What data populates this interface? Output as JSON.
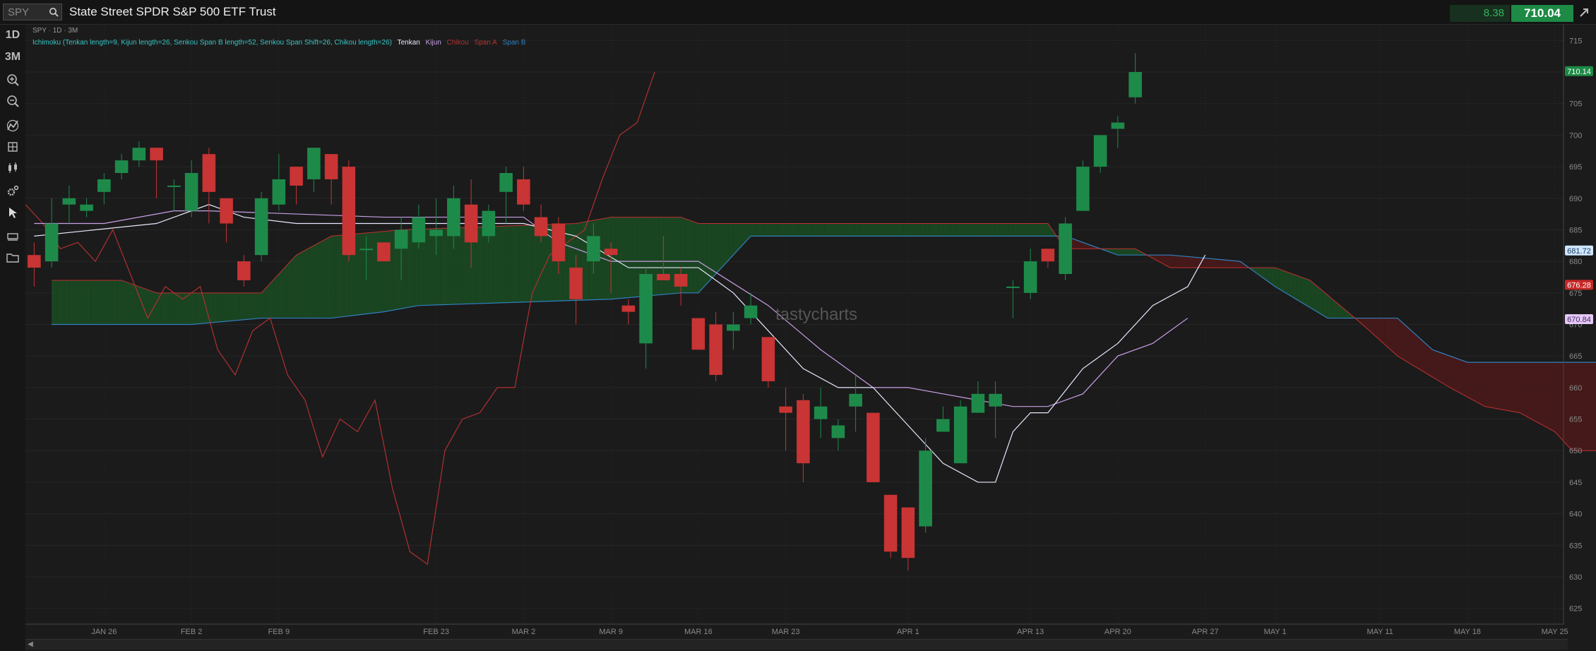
{
  "header": {
    "symbol": "SPY",
    "title": "State Street SPDR S&P 500 ETF Trust",
    "change": "8.38",
    "price": "710.04"
  },
  "sidebar": {
    "timeframes": [
      "1D",
      "3M"
    ],
    "tools": [
      "zoom-in-icon",
      "zoom-out-icon",
      "studies-icon",
      "drawing-icon",
      "chart-style-icon",
      "settings-icon",
      "cursor-icon",
      "layers-icon",
      "folder-icon"
    ]
  },
  "chart": {
    "info": "SPY · 1D · 3M",
    "study_params": "Ichimoku (Tenkan length=9, Kijun length=26, Senkou Span B length=52, Senkou Span Shift=26, Chikou length=26)",
    "legend": [
      {
        "label": "Tenkan",
        "color": "#e8e8ff"
      },
      {
        "label": "Kijun",
        "color": "#c8a0e8"
      },
      {
        "label": "Chikou",
        "color": "#b03030"
      },
      {
        "label": "Span A",
        "color": "#c03030"
      },
      {
        "label": "Span B",
        "color": "#3080c0"
      }
    ],
    "watermark": "tastycharts",
    "price_badges": [
      {
        "value": "710.14",
        "bg": "#1d8a45",
        "fg": "#ffffff"
      },
      {
        "value": "681.72",
        "bg": "#cfe6ff",
        "fg": "#1a3a5a"
      },
      {
        "value": "676.28",
        "bg": "#c62828",
        "fg": "#ffffff"
      },
      {
        "value": "670.84",
        "bg": "#e4c9f5",
        "fg": "#4a2a6a"
      }
    ]
  },
  "chart_data": {
    "type": "candlestick",
    "ylim": [
      622.5,
      717.5
    ],
    "y_ticks": [
      625,
      630,
      635,
      640,
      645,
      650,
      655,
      660,
      665,
      670,
      675,
      680,
      685,
      690,
      695,
      700,
      705,
      710,
      715
    ],
    "x_labels": [
      "JAN 26",
      "FEB 2",
      "FEB 9",
      "FEB 23",
      "MAR 2",
      "MAR 9",
      "MAR 16",
      "MAR 23",
      "APR 1",
      "APR 13",
      "APR 20",
      "APR 27",
      "MAY 1",
      "MAY 11",
      "MAY 18",
      "MAY 25"
    ],
    "x_label_index": [
      4,
      9,
      14,
      23,
      28,
      33,
      38,
      43,
      50,
      57,
      62,
      67,
      71,
      77,
      82,
      87
    ],
    "x_range": [
      -0.5,
      87.5
    ],
    "colors": {
      "up": "#1e8a4a",
      "down": "#c93434",
      "cloud_green": "#1b4a22",
      "cloud_red": "#4a1a1a"
    },
    "candles": [
      [
        681,
        679,
        683,
        676
      ],
      [
        680,
        686,
        690,
        679
      ],
      [
        689,
        690,
        692,
        686
      ],
      [
        688,
        689,
        690,
        687
      ],
      [
        691,
        693,
        694,
        689
      ],
      [
        694,
        696,
        697,
        693
      ],
      [
        696,
        698,
        699,
        695
      ],
      [
        698,
        696,
        698,
        690
      ],
      [
        692,
        692,
        693,
        688
      ],
      [
        688,
        694,
        696,
        687
      ],
      [
        697,
        691,
        698,
        686
      ],
      [
        690,
        686,
        690,
        683
      ],
      [
        680,
        677,
        681,
        676
      ],
      [
        681,
        690,
        691,
        680
      ],
      [
        689,
        693,
        697,
        688
      ],
      [
        695,
        692,
        695,
        689
      ],
      [
        693,
        698,
        698,
        691
      ],
      [
        697,
        693,
        697,
        689
      ],
      [
        695,
        681,
        696,
        680
      ],
      [
        682,
        682,
        684,
        677
      ],
      [
        683,
        680,
        682,
        683
      ],
      [
        682,
        685,
        687,
        677
      ],
      [
        683,
        687,
        689,
        682
      ],
      [
        684,
        685,
        690,
        681
      ],
      [
        684,
        690,
        692,
        682
      ],
      [
        689,
        683,
        693,
        679
      ],
      [
        684,
        688,
        689,
        683
      ],
      [
        691,
        694,
        695,
        686
      ],
      [
        693,
        689,
        695,
        688
      ],
      [
        687,
        684,
        689,
        683
      ],
      [
        686,
        680,
        687,
        678
      ],
      [
        679,
        674,
        681,
        670
      ],
      [
        680,
        684,
        686,
        678
      ],
      [
        682,
        681,
        683,
        675
      ],
      [
        673,
        672,
        674,
        670
      ],
      [
        667,
        678,
        679,
        663
      ],
      [
        678,
        677,
        684,
        677
      ],
      [
        678,
        676,
        679,
        673
      ],
      [
        671,
        666,
        671,
        666
      ],
      [
        670,
        662,
        672,
        661
      ],
      [
        669,
        670,
        672,
        666
      ],
      [
        671,
        673,
        675,
        670
      ],
      [
        668,
        661,
        668,
        660
      ],
      [
        657,
        656,
        660,
        650
      ],
      [
        658,
        648,
        659,
        645
      ],
      [
        655,
        657,
        660,
        652
      ],
      [
        652,
        654,
        655,
        650
      ],
      [
        657,
        659,
        662,
        653
      ],
      [
        656,
        645,
        656,
        645
      ],
      [
        643,
        634,
        643,
        633
      ],
      [
        641,
        633,
        641,
        631
      ],
      [
        638,
        650,
        652,
        637
      ],
      [
        653,
        655,
        657,
        653
      ],
      [
        648,
        657,
        658,
        648
      ],
      [
        656,
        659,
        661,
        656
      ],
      [
        657,
        659,
        661,
        652
      ],
      [
        676,
        676,
        677,
        671
      ],
      [
        675,
        680,
        682,
        674
      ],
      [
        682,
        680,
        682,
        679
      ],
      [
        678,
        686,
        687,
        677
      ],
      [
        688,
        695,
        696,
        688
      ],
      [
        695,
        700,
        700,
        694
      ],
      [
        701,
        702,
        703,
        698
      ],
      [
        706,
        710,
        713,
        705
      ]
    ],
    "chikou": [
      [
        -0.5,
        689
      ],
      [
        0.5,
        686
      ],
      [
        1.5,
        682
      ],
      [
        2.5,
        683
      ],
      [
        3.5,
        680
      ],
      [
        4.5,
        685
      ],
      [
        5.5,
        678
      ],
      [
        6.5,
        671
      ],
      [
        7.5,
        676
      ],
      [
        8.5,
        674
      ],
      [
        9.5,
        676
      ],
      [
        10.5,
        666
      ],
      [
        11.5,
        662
      ],
      [
        12.5,
        669
      ],
      [
        13.5,
        671
      ],
      [
        14.5,
        662
      ],
      [
        15.5,
        658
      ],
      [
        16.5,
        649
      ],
      [
        17.5,
        655
      ],
      [
        18.5,
        653
      ],
      [
        19.5,
        658
      ],
      [
        20.5,
        644
      ],
      [
        21.5,
        634
      ],
      [
        22.5,
        632
      ],
      [
        23.5,
        650
      ],
      [
        24.5,
        655
      ],
      [
        25.5,
        656
      ],
      [
        26.5,
        660
      ],
      [
        27.5,
        660
      ],
      [
        28.5,
        675
      ],
      [
        29.5,
        681
      ],
      [
        30.5,
        683
      ],
      [
        31.5,
        685
      ],
      [
        32.5,
        693
      ],
      [
        33.5,
        700
      ],
      [
        34.5,
        702
      ],
      [
        35.5,
        710
      ]
    ],
    "tenkan": [
      [
        0,
        684
      ],
      [
        7,
        686
      ],
      [
        10,
        689
      ],
      [
        12,
        687
      ],
      [
        15,
        686
      ],
      [
        28,
        686
      ],
      [
        31,
        684
      ],
      [
        34,
        679
      ],
      [
        38,
        679
      ],
      [
        40,
        675
      ],
      [
        42,
        669
      ],
      [
        44,
        663
      ],
      [
        46,
        660
      ],
      [
        48,
        660
      ],
      [
        50,
        654
      ],
      [
        52,
        648
      ],
      [
        54,
        645
      ],
      [
        55,
        645
      ],
      [
        56,
        653
      ],
      [
        57,
        656
      ],
      [
        58,
        656
      ],
      [
        60,
        663
      ],
      [
        62,
        667
      ],
      [
        64,
        673
      ],
      [
        66,
        676
      ],
      [
        67,
        681
      ]
    ],
    "kijun": [
      [
        0,
        686
      ],
      [
        4,
        686
      ],
      [
        8,
        688
      ],
      [
        10,
        688
      ],
      [
        20,
        687
      ],
      [
        28,
        687
      ],
      [
        30,
        683
      ],
      [
        33,
        680
      ],
      [
        38,
        680
      ],
      [
        42,
        673
      ],
      [
        45,
        666
      ],
      [
        48,
        660
      ],
      [
        50,
        660
      ],
      [
        52,
        659
      ],
      [
        54,
        658
      ],
      [
        56,
        657
      ],
      [
        58,
        657
      ],
      [
        60,
        659
      ],
      [
        62,
        665
      ],
      [
        64,
        667
      ],
      [
        66,
        671
      ]
    ],
    "span_a": [
      [
        1,
        677
      ],
      [
        5,
        677
      ],
      [
        7,
        675
      ],
      [
        13,
        675
      ],
      [
        15,
        681
      ],
      [
        17,
        684
      ],
      [
        21,
        685
      ],
      [
        31,
        686
      ],
      [
        33,
        687
      ],
      [
        37,
        687
      ],
      [
        38,
        686
      ],
      [
        54,
        686
      ],
      [
        58,
        686
      ],
      [
        59,
        682
      ],
      [
        63,
        682
      ],
      [
        65,
        679
      ],
      [
        71,
        679
      ],
      [
        73,
        677
      ],
      [
        76,
        670
      ],
      [
        78,
        665
      ],
      [
        81,
        660
      ],
      [
        83,
        657
      ],
      [
        85,
        656
      ],
      [
        87,
        653
      ],
      [
        88,
        650
      ],
      [
        91,
        650
      ],
      [
        93,
        657
      ],
      [
        94,
        658
      ],
      [
        96,
        657
      ],
      [
        98,
        662
      ],
      [
        99,
        668
      ],
      [
        101,
        672
      ],
      [
        102,
        676
      ]
    ],
    "span_b": [
      [
        1,
        670
      ],
      [
        9,
        670
      ],
      [
        13,
        671
      ],
      [
        17,
        671
      ],
      [
        20,
        672
      ],
      [
        22,
        673
      ],
      [
        33,
        674
      ],
      [
        37,
        675
      ],
      [
        38,
        675
      ],
      [
        41,
        684
      ],
      [
        44,
        684
      ],
      [
        56,
        684
      ],
      [
        59,
        684
      ],
      [
        62,
        681
      ],
      [
        65,
        681
      ],
      [
        69,
        680
      ],
      [
        71,
        676
      ],
      [
        74,
        671
      ],
      [
        78,
        671
      ],
      [
        80,
        666
      ],
      [
        82,
        664
      ],
      [
        88,
        664
      ],
      [
        96,
        664
      ],
      [
        97,
        663
      ],
      [
        99,
        665
      ],
      [
        101,
        667
      ],
      [
        102,
        671
      ]
    ]
  }
}
